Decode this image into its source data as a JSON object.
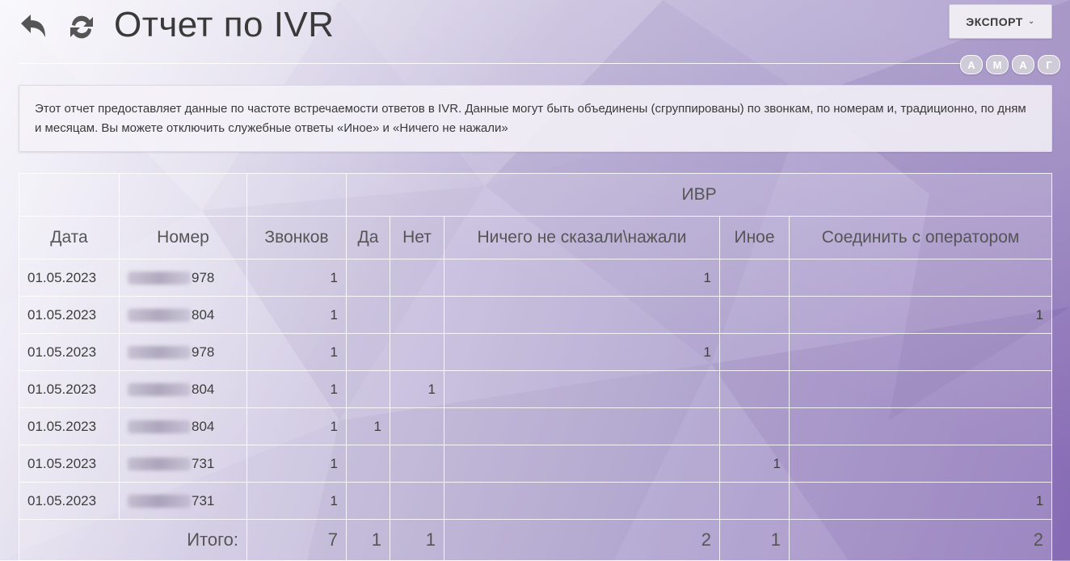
{
  "page": {
    "title": "Отчет по IVR",
    "export_label": "ЭКСПОРТ",
    "font_buttons": [
      "А",
      "М",
      "А",
      "Г"
    ]
  },
  "info": {
    "text": "Этот отчет предоставляет данные по частоте встречаемости ответов в IVR. Данные могут быть объединены (сгруппированы) по звонкам, по номерам и, традиционно, по дням и месяцам. Вы можете отключить служебные ответы «Иное» и «Ничего не нажали»"
  },
  "table": {
    "group_label": "ИВР",
    "headers": [
      "Дата",
      "Номер",
      "Звонков",
      "Да",
      "Нет",
      "Ничего не сказали\\нажали",
      "Иное",
      "Соединить с оператором"
    ],
    "rows": [
      {
        "date": "01.05.2023",
        "number": "978",
        "calls": "1",
        "yes": "",
        "no": "",
        "nothing": "1",
        "other": "",
        "operator": ""
      },
      {
        "date": "01.05.2023",
        "number": "804",
        "calls": "1",
        "yes": "",
        "no": "",
        "nothing": "",
        "other": "",
        "operator": "1"
      },
      {
        "date": "01.05.2023",
        "number": "978",
        "calls": "1",
        "yes": "",
        "no": "",
        "nothing": "1",
        "other": "",
        "operator": ""
      },
      {
        "date": "01.05.2023",
        "number": "804",
        "calls": "1",
        "yes": "",
        "no": "1",
        "nothing": "",
        "other": "",
        "operator": ""
      },
      {
        "date": "01.05.2023",
        "number": "804",
        "calls": "1",
        "yes": "1",
        "no": "",
        "nothing": "",
        "other": "",
        "operator": ""
      },
      {
        "date": "01.05.2023",
        "number": "731",
        "calls": "1",
        "yes": "",
        "no": "",
        "nothing": "",
        "other": "1",
        "operator": ""
      },
      {
        "date": "01.05.2023",
        "number": "731",
        "calls": "1",
        "yes": "",
        "no": "",
        "nothing": "",
        "other": "",
        "operator": "1"
      }
    ],
    "total": {
      "label": "Итого:",
      "calls": "7",
      "yes": "1",
      "no": "1",
      "nothing": "2",
      "other": "1",
      "operator": "2"
    }
  },
  "icons": {
    "back": "undo-arrow-icon",
    "refresh": "refresh-icon",
    "export_chevron": "chevron-down-icon"
  }
}
